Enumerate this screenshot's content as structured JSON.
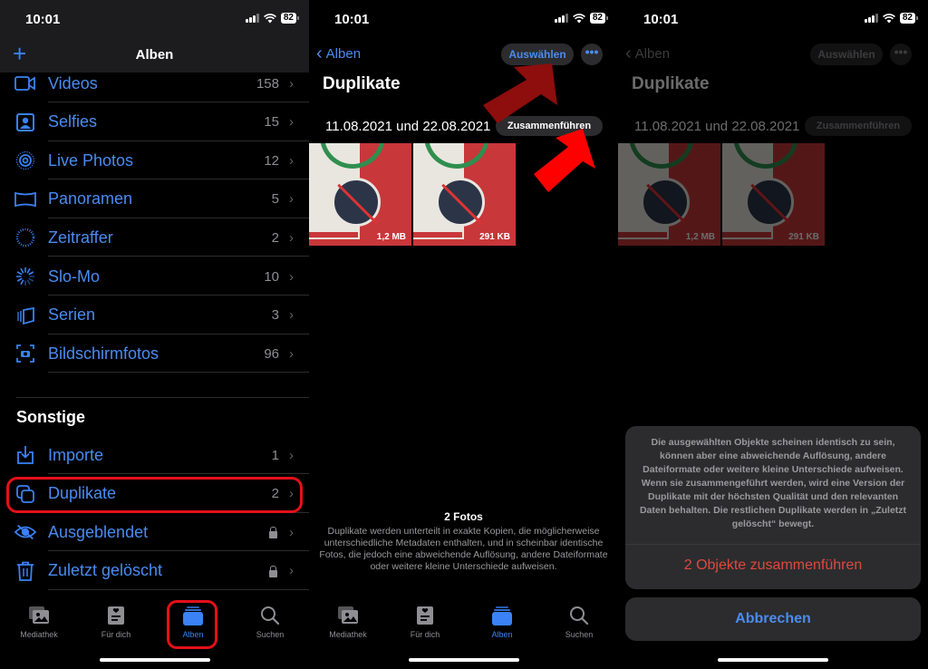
{
  "status_bar": {
    "time": "10:01",
    "battery": "82"
  },
  "albums_screen": {
    "title": "Alben",
    "add_icon": "plus-icon",
    "items": [
      {
        "icon": "video-icon",
        "label": "Videos",
        "count": "158"
      },
      {
        "icon": "selfie-icon",
        "label": "Selfies",
        "count": "15"
      },
      {
        "icon": "live-photo-icon",
        "label": "Live Photos",
        "count": "12"
      },
      {
        "icon": "panorama-icon",
        "label": "Panoramen",
        "count": "5"
      },
      {
        "icon": "timelapse-icon",
        "label": "Zeitraffer",
        "count": "2"
      },
      {
        "icon": "slomo-icon",
        "label": "Slo-Mo",
        "count": "10"
      },
      {
        "icon": "burst-icon",
        "label": "Serien",
        "count": "3"
      },
      {
        "icon": "screenshot-icon",
        "label": "Bildschirmfotos",
        "count": "96"
      }
    ],
    "section_title": "Sonstige",
    "other_items": [
      {
        "icon": "import-icon",
        "label": "Importe",
        "count": "1",
        "locked": false
      },
      {
        "icon": "duplicate-icon",
        "label": "Duplikate",
        "count": "2",
        "locked": false,
        "highlighted": true
      },
      {
        "icon": "hidden-icon",
        "label": "Ausgeblendet",
        "count": "",
        "locked": true
      },
      {
        "icon": "trash-icon",
        "label": "Zuletzt gelöscht",
        "count": "",
        "locked": true
      }
    ]
  },
  "tabbar": {
    "tabs": [
      {
        "icon": "library-icon",
        "label": "Mediathek",
        "active": false
      },
      {
        "icon": "for-you-icon",
        "label": "Für dich",
        "active": false
      },
      {
        "icon": "albums-icon",
        "label": "Alben",
        "active": true
      },
      {
        "icon": "search-icon",
        "label": "Suchen",
        "active": false
      }
    ]
  },
  "duplicates_screen": {
    "back_label": "Alben",
    "select_label": "Auswählen",
    "more_label": "•••",
    "title": "Duplikate",
    "group_dates": "11.08.2021 und 22.08.2021",
    "merge_label": "Zusammenführen",
    "photos": [
      {
        "size": "1,2 MB"
      },
      {
        "size": "291 KB"
      }
    ],
    "footer_count": "2 Fotos",
    "footer_description": "Duplikate werden unterteilt in exakte Kopien, die möglicherweise unterschiedliche Metadaten enthalten, und in scheinbar identische Fotos, die jedoch eine abweichende Auflösung, andere Dateiformate oder weitere kleine Unterschiede aufweisen."
  },
  "merge_sheet": {
    "message": "Die ausgewählten Objekte scheinen identisch zu sein, können aber eine abweichende Auflösung, andere Dateiformate oder weitere kleine Unterschiede aufweisen. Wenn sie zusammengeführt werden, wird eine Version der Duplikate mit der höchsten Qualität und den relevanten Daten behalten. Die restlichen Duplikate werden in „Zuletzt gelöscht“ bewegt.",
    "confirm_label": "2 Objekte zusammenführen",
    "cancel_label": "Abbrechen"
  },
  "colors": {
    "accent": "#3a82f6",
    "destructive": "#e0483e",
    "annotation": "#e4101a"
  }
}
